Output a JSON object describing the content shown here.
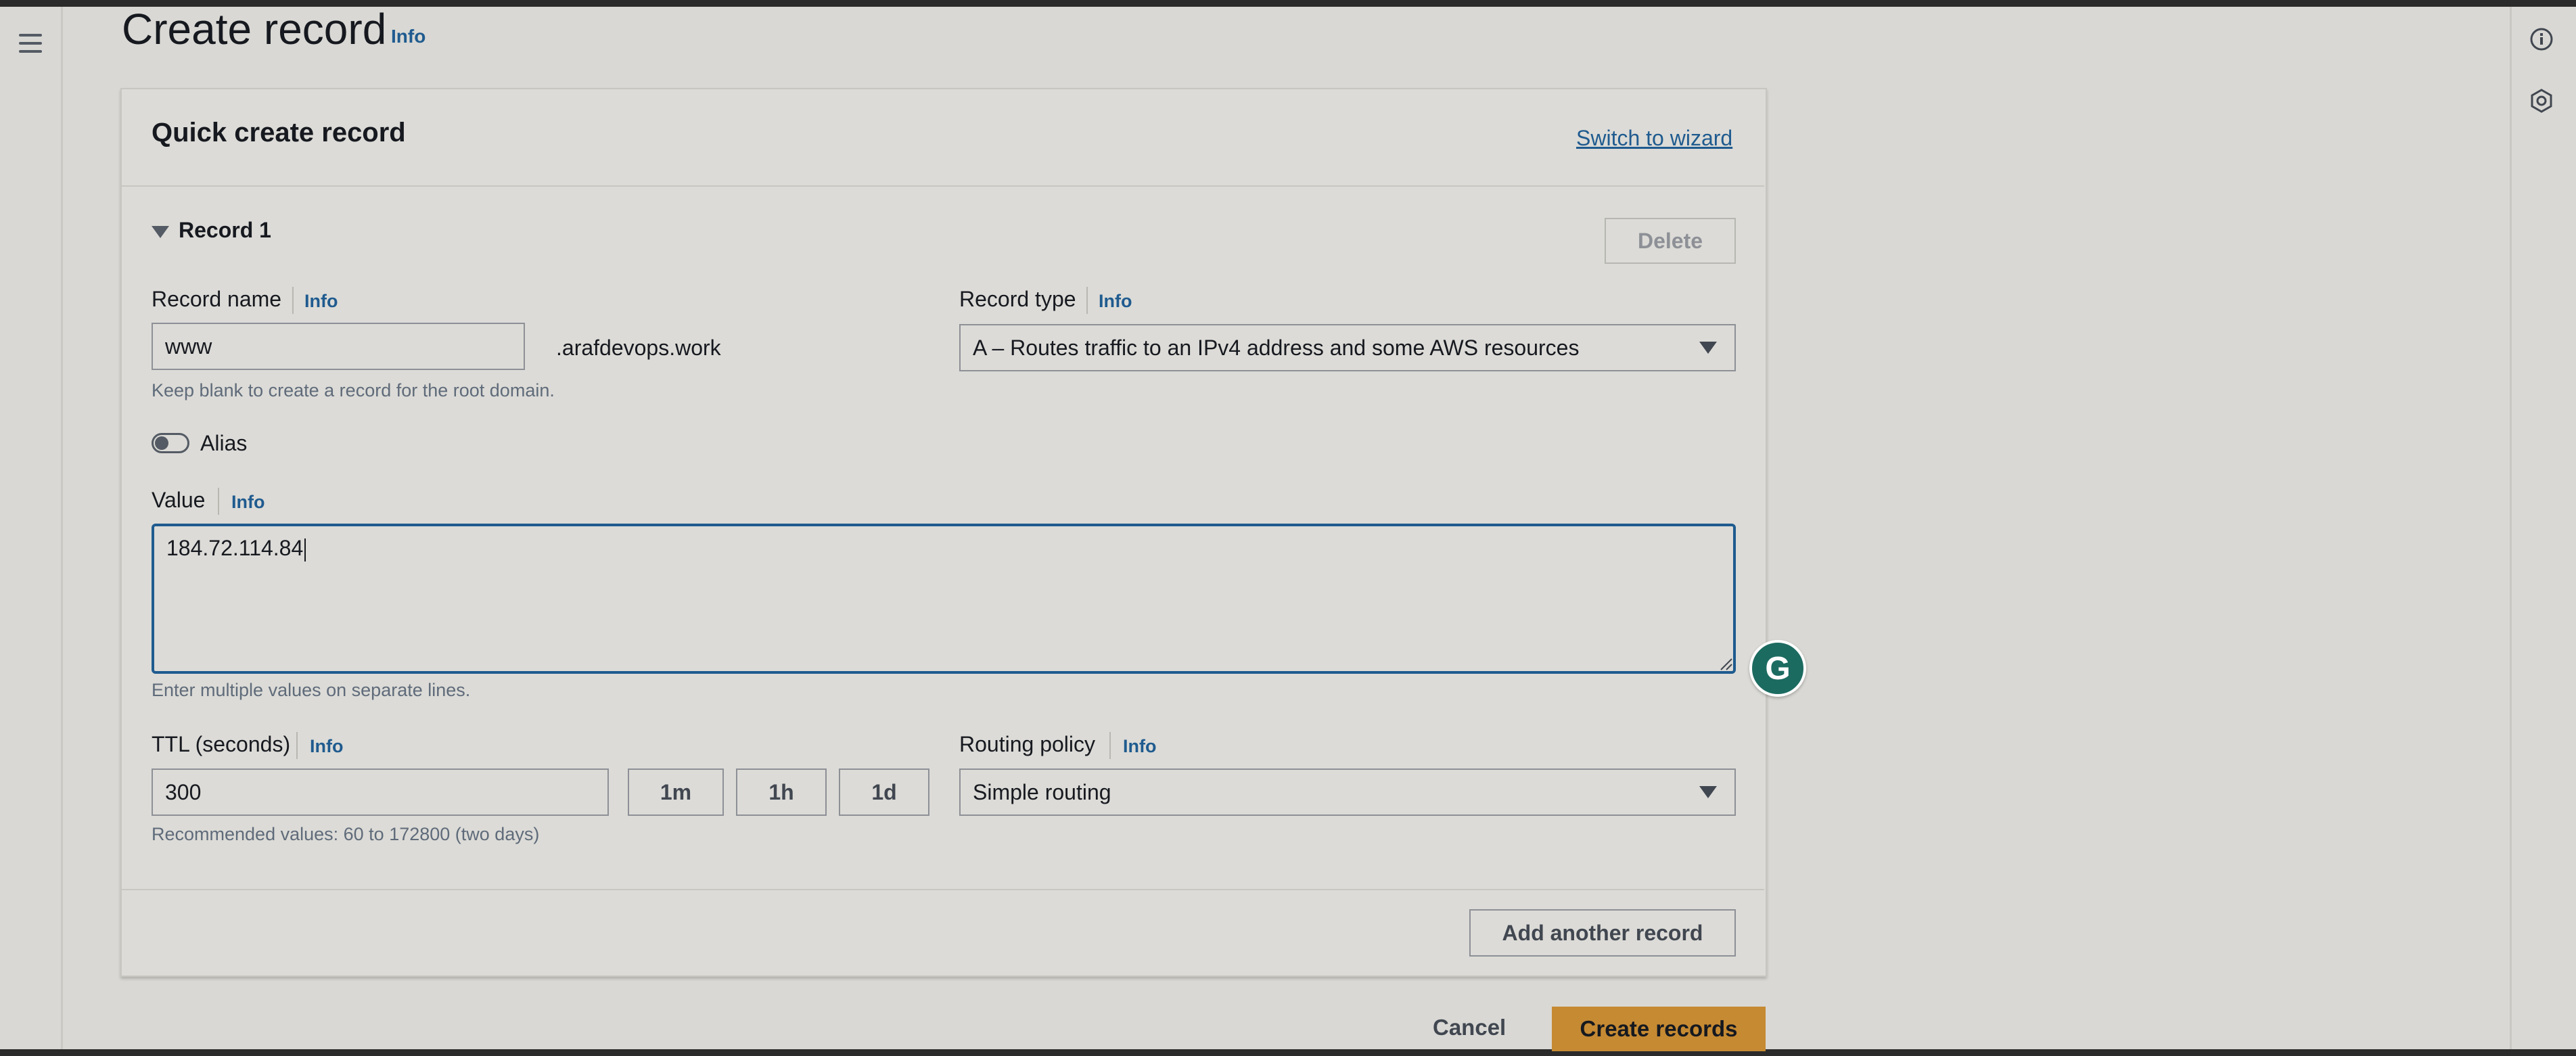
{
  "page": {
    "title": "Create record",
    "title_info": "Info"
  },
  "panel": {
    "title": "Quick create record",
    "switch_link": "Switch to wizard"
  },
  "record": {
    "label": "Record 1",
    "delete_label": "Delete",
    "name_label": "Record name",
    "name_info": "Info",
    "name_value": ".arafdevops.work",
    "name_input": "www",
    "name_hint": "Keep blank to create a record for the root domain.",
    "type_label": "Record type",
    "type_info": "Info",
    "type_value": "A – Routes traffic to an IPv4 address and some AWS resources",
    "alias_label": "Alias",
    "alias_enabled": false,
    "value_label": "Value",
    "value_info": "Info",
    "value_text": "184.72.114.84",
    "value_hint": "Enter multiple values on separate lines.",
    "ttl_label": "TTL (seconds)",
    "ttl_info": "Info",
    "ttl_value": "300",
    "ttl_buttons": [
      "1m",
      "1h",
      "1d"
    ],
    "ttl_hint": "Recommended values: 60 to 172800 (two days)",
    "routing_label": "Routing policy",
    "routing_info": "Info",
    "routing_value": "Simple routing",
    "add_another_label": "Add another record"
  },
  "footer": {
    "cancel_label": "Cancel",
    "create_label": "Create records"
  },
  "grammarly": {
    "glyph": "G"
  },
  "colors": {
    "primary_button": "#c68a33",
    "link": "#1f5b8f",
    "focus_border": "#1f5b8f"
  }
}
